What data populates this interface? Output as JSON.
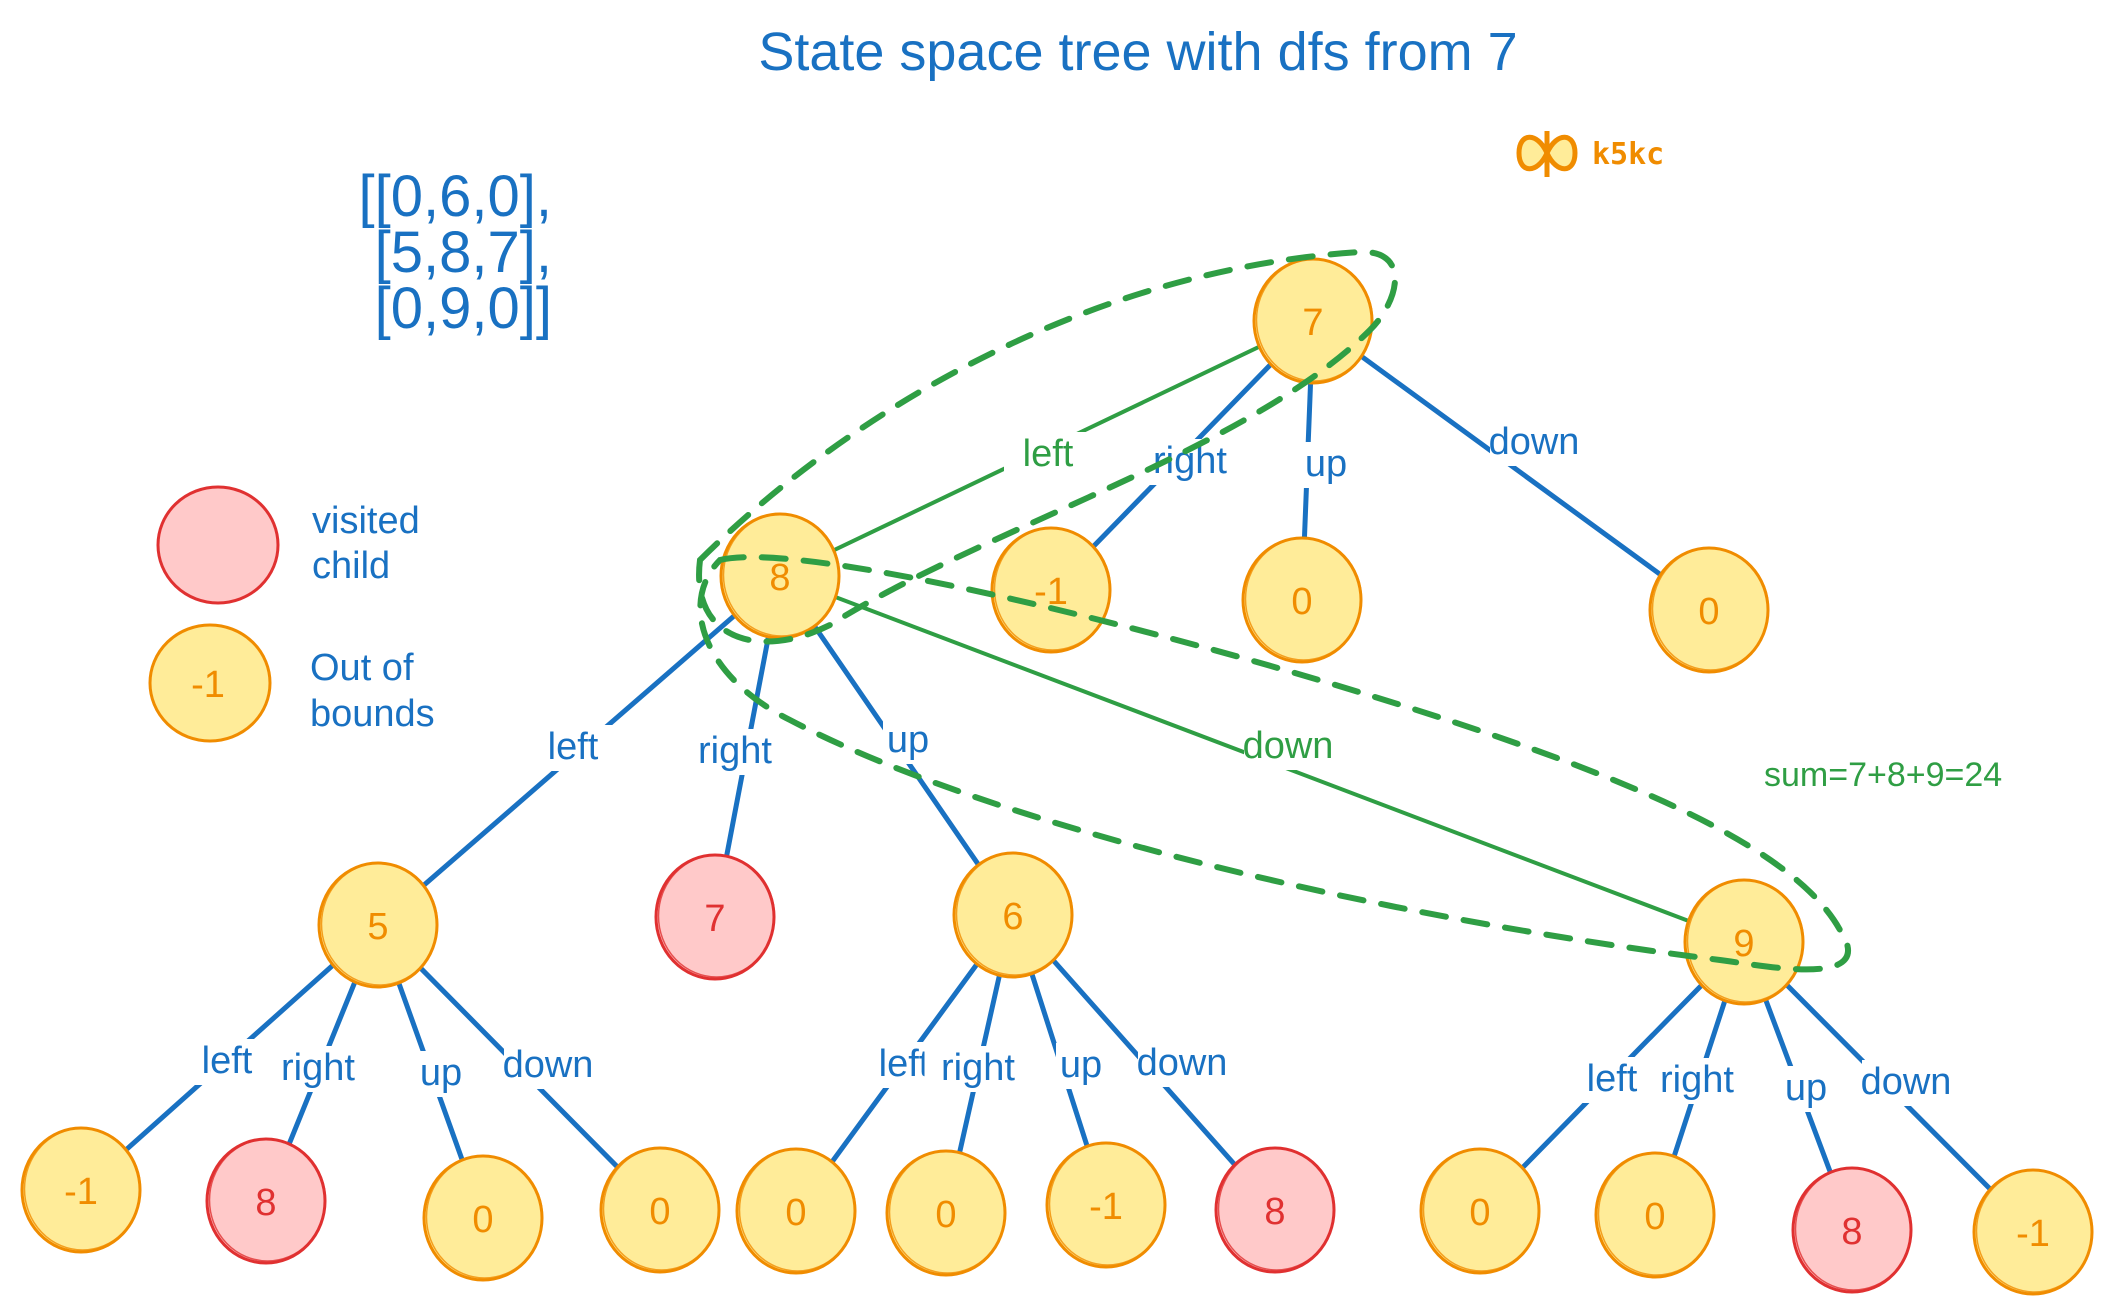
{
  "title": "State space tree with dfs from 7",
  "brand": {
    "icon": "butterfly-logo-icon",
    "label": "k5kc"
  },
  "matrix": {
    "lines": [
      "[[0,6,0],",
      "[5,8,7],",
      "[0,9,0]]"
    ]
  },
  "legend": [
    {
      "kind": "visited",
      "value": "",
      "label_lines": [
        "visited",
        "child"
      ]
    },
    {
      "kind": "normal",
      "value": "-1",
      "label_lines": [
        "Out of",
        "bounds"
      ]
    }
  ],
  "annotation": "sum=7+8+9=24",
  "colors": {
    "blue": "#1971c2",
    "green": "#2f9e44",
    "node_fill": "#ffec99",
    "node_stroke": "#f08c00",
    "node_text": "#f08c00",
    "visited_fill": "#ffc9c9",
    "visited_stroke": "#e03131",
    "visited_text": "#e03131"
  },
  "tree": {
    "nodes": [
      {
        "id": "n7",
        "value": "7",
        "kind": "normal",
        "on_path": true
      },
      {
        "id": "n8",
        "value": "8",
        "kind": "normal",
        "on_path": true
      },
      {
        "id": "n7_right",
        "value": "-1",
        "kind": "normal"
      },
      {
        "id": "n7_up",
        "value": "0",
        "kind": "normal"
      },
      {
        "id": "n7_down",
        "value": "0",
        "kind": "normal"
      },
      {
        "id": "n5",
        "value": "5",
        "kind": "normal"
      },
      {
        "id": "n8_right",
        "value": "7",
        "kind": "visited"
      },
      {
        "id": "n6",
        "value": "6",
        "kind": "normal"
      },
      {
        "id": "n9",
        "value": "9",
        "kind": "normal",
        "on_path": true
      },
      {
        "id": "n5_left",
        "value": "-1",
        "kind": "normal"
      },
      {
        "id": "n5_right",
        "value": "8",
        "kind": "visited"
      },
      {
        "id": "n5_up",
        "value": "0",
        "kind": "normal"
      },
      {
        "id": "n5_down",
        "value": "0",
        "kind": "normal"
      },
      {
        "id": "n6_left",
        "value": "0",
        "kind": "normal"
      },
      {
        "id": "n6_right",
        "value": "0",
        "kind": "normal"
      },
      {
        "id": "n6_up",
        "value": "-1",
        "kind": "normal"
      },
      {
        "id": "n6_down",
        "value": "8",
        "kind": "visited"
      },
      {
        "id": "n9_left",
        "value": "0",
        "kind": "normal"
      },
      {
        "id": "n9_right",
        "value": "0",
        "kind": "normal"
      },
      {
        "id": "n9_up",
        "value": "8",
        "kind": "visited"
      },
      {
        "id": "n9_down",
        "value": "-1",
        "kind": "normal"
      }
    ],
    "edges": [
      {
        "from": "n7",
        "to": "n8",
        "label": "left",
        "highlight": true
      },
      {
        "from": "n7",
        "to": "n7_right",
        "label": "right"
      },
      {
        "from": "n7",
        "to": "n7_up",
        "label": "up"
      },
      {
        "from": "n7",
        "to": "n7_down",
        "label": "down"
      },
      {
        "from": "n8",
        "to": "n5",
        "label": "left"
      },
      {
        "from": "n8",
        "to": "n8_right",
        "label": "right"
      },
      {
        "from": "n8",
        "to": "n6",
        "label": "up"
      },
      {
        "from": "n8",
        "to": "n9",
        "label": "down",
        "highlight": true
      },
      {
        "from": "n5",
        "to": "n5_left",
        "label": "left"
      },
      {
        "from": "n5",
        "to": "n5_right",
        "label": "right"
      },
      {
        "from": "n5",
        "to": "n5_up",
        "label": "up"
      },
      {
        "from": "n5",
        "to": "n5_down",
        "label": "down"
      },
      {
        "from": "n6",
        "to": "n6_left",
        "label": "left"
      },
      {
        "from": "n6",
        "to": "n6_right",
        "label": "right"
      },
      {
        "from": "n6",
        "to": "n6_up",
        "label": "up"
      },
      {
        "from": "n6",
        "to": "n6_down",
        "label": "down"
      },
      {
        "from": "n9",
        "to": "n9_left",
        "label": "left"
      },
      {
        "from": "n9",
        "to": "n9_right",
        "label": "right"
      },
      {
        "from": "n9",
        "to": "n9_up",
        "label": "up"
      },
      {
        "from": "n9",
        "to": "n9_down",
        "label": "down"
      }
    ],
    "highlighted_path": [
      "n7",
      "n8",
      "n9"
    ]
  }
}
